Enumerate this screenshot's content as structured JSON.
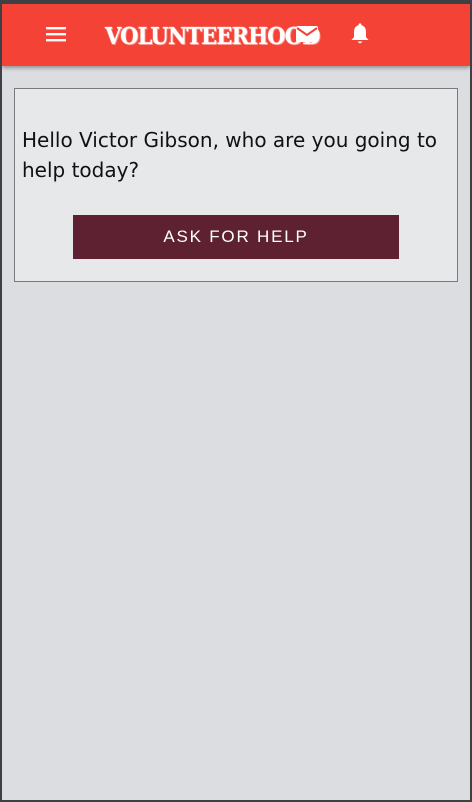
{
  "appbar": {
    "brand": "VOLUNTEERHOOD",
    "background": "#f44336",
    "icons": {
      "menu": "menu-icon",
      "mail": "mail-icon",
      "notifications": "bell-icon",
      "logo_hand": "hand-icon"
    }
  },
  "card": {
    "greeting": "Hello Victor Gibson, who are you going to help today?",
    "ask_button_label": "ASK FOR HELP",
    "ask_button_color": "#5e2131"
  },
  "page_background": "#dcdde0"
}
